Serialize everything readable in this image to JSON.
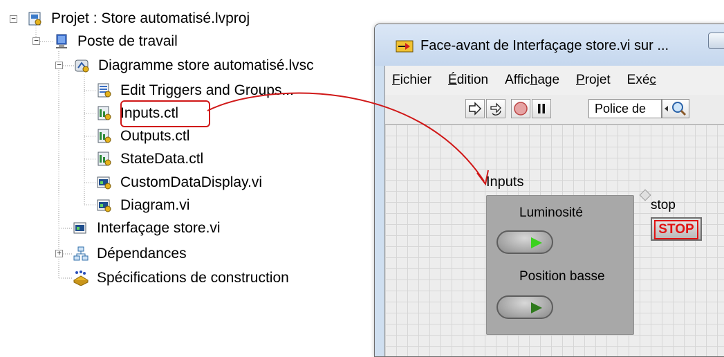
{
  "tree": {
    "project": "Projet : Store automatisé.lvproj",
    "workstation": "Poste de travail",
    "diagram": "Diagramme store automatisé.lvsc",
    "children": [
      "Edit Triggers and Groups...",
      "Inputs.ctl",
      "Outputs.ctl",
      "StateData.ctl",
      "CustomDataDisplay.vi",
      "Diagram.vi"
    ],
    "interface_vi": "Interfaçage store.vi",
    "dependencies": "Dépendances",
    "build_specs": "Spécifications de construction",
    "expander_collapsed": "+",
    "expander_expanded": "−"
  },
  "window": {
    "title": "Face-avant de Interfaçage store.vi sur ...",
    "menu": [
      {
        "ul": "F",
        "rest": "ichier"
      },
      {
        "ul": "É",
        "rest": "dition"
      },
      {
        "pre": "Affic",
        "ul": "h",
        "rest": "age"
      },
      {
        "ul": "P",
        "rest": "rojet"
      },
      {
        "pre": "Exé",
        "ul": "c",
        "rest": ""
      }
    ],
    "font_box": "Police de"
  },
  "panel": {
    "cluster_label": "Inputs",
    "luminosity_label": "Luminosité",
    "low_position_label": "Position basse",
    "stop_label": "stop",
    "stop_button": "STOP"
  },
  "colors": {
    "highlight": "#d01818",
    "led_on": "#3bd11f",
    "led_off": "#2f7a1d",
    "stop_text": "#e21212"
  }
}
